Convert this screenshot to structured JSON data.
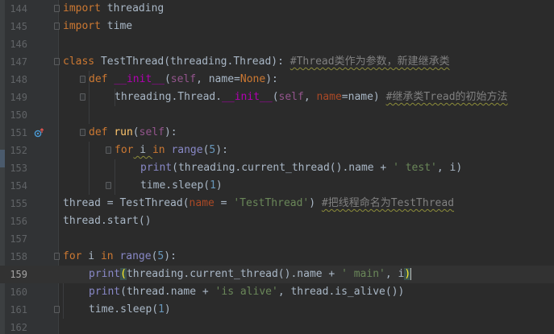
{
  "editor": {
    "colors": {
      "background": "#2b2b2b",
      "gutter": "#313335",
      "keyword": "#cc7832",
      "string": "#6a8759",
      "number": "#6897bb",
      "self": "#94558d",
      "magic": "#b200b2",
      "function": "#ffc66d",
      "builtin": "#8888c6",
      "comment": "#808080",
      "text": "#a9b7c6"
    },
    "current_line": 159,
    "lines": [
      {
        "n": "144",
        "t": {
          "a": "import",
          "b": " threading"
        }
      },
      {
        "n": "145",
        "t": {
          "a": "import",
          "b": " time"
        }
      },
      {
        "n": "146",
        "t": {}
      },
      {
        "n": "147",
        "t": {
          "a": "class",
          "b": " TestThread(threading.Thread): ",
          "c": "#Thread类作为参数，新建继承类"
        }
      },
      {
        "n": "148",
        "t": {
          "a": "def",
          "b": " ",
          "c": "__init__",
          "d": "(",
          "e": "self",
          "f": ", name=",
          "g": "None",
          "h": "):"
        }
      },
      {
        "n": "149",
        "t": {
          "a": "threading.Thread.",
          "b": "__init__",
          "c": "(",
          "d": "self",
          "e": ", ",
          "f": "name",
          "g": "=name) ",
          "h": "#继承类Tread的初始方法"
        }
      },
      {
        "n": "150",
        "t": {}
      },
      {
        "n": "151",
        "t": {
          "a": "def",
          "b": " ",
          "c": "run",
          "d": "(",
          "e": "self",
          "f": "):"
        }
      },
      {
        "n": "152",
        "t": {
          "a": "for",
          "b": " i ",
          "c": "in",
          "d": " ",
          "e": "range",
          "f": "(",
          "g": "5",
          "h": "):"
        }
      },
      {
        "n": "153",
        "t": {
          "a": "print",
          "b": "(threading.current_thread().name + ",
          "c": "' test'",
          "d": ", i)"
        }
      },
      {
        "n": "154",
        "t": {
          "a": "time.sleep(",
          "b": "1",
          "c": ")"
        }
      },
      {
        "n": "155",
        "t": {
          "a": "thread = TestThread(",
          "b": "name",
          "c": " = ",
          "d": "'TestThread'",
          "e": ") ",
          "f": "#把线程命名为TestThread"
        }
      },
      {
        "n": "156",
        "t": {
          "a": "thread.start()"
        }
      },
      {
        "n": "157",
        "t": {}
      },
      {
        "n": "158",
        "t": {
          "a": "for",
          "b": " i ",
          "c": "in",
          "d": " ",
          "e": "range",
          "f": "(",
          "g": "5",
          "h": "):"
        }
      },
      {
        "n": "159",
        "t": {
          "a": "print",
          "b": "(",
          "c": "threading.current_thread().name + ",
          "d": "' main'",
          "e": ", i",
          "f": ")"
        }
      },
      {
        "n": "160",
        "t": {
          "a": "print",
          "b": "(thread.name + ",
          "c": "'is alive'",
          "d": ", thread.is_alive())"
        }
      },
      {
        "n": "161",
        "t": {
          "a": "time.sleep(",
          "b": "1",
          "c": ")"
        }
      },
      {
        "n": "162",
        "t": {}
      }
    ]
  }
}
